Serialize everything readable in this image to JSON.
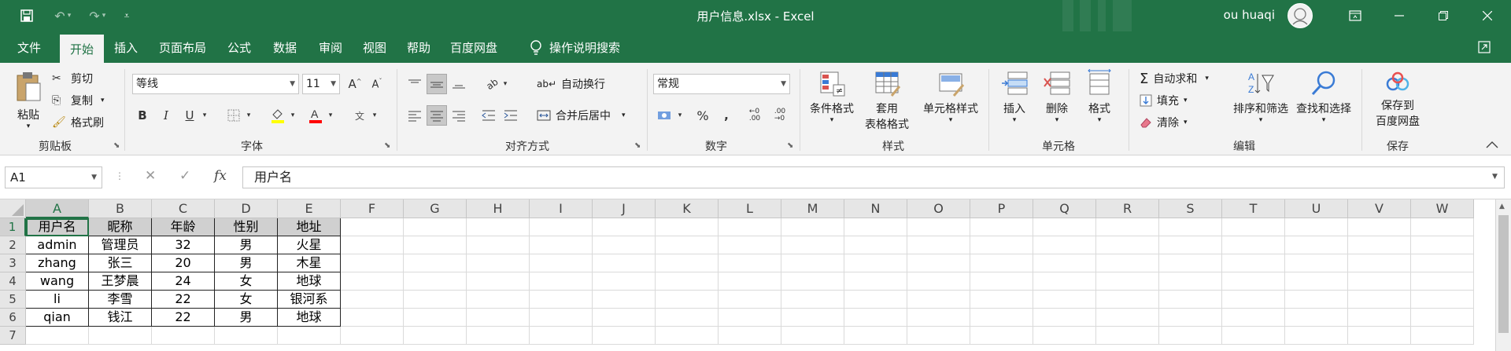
{
  "titlebar": {
    "doc_title": "用户信息.xlsx  -  Excel",
    "user_name": "ou huaqi",
    "brand_color": "#217346"
  },
  "tabs": [
    "文件",
    "开始",
    "插入",
    "页面布局",
    "公式",
    "数据",
    "审阅",
    "视图",
    "帮助",
    "百度网盘"
  ],
  "active_tab": "开始",
  "tell_me": "操作说明搜索",
  "ribbon": {
    "clipboard": {
      "paste": "粘贴",
      "cut": "剪切",
      "copy": "复制",
      "format_painter": "格式刷",
      "label": "剪贴板"
    },
    "font": {
      "name": "等线",
      "size": "11",
      "label": "字体",
      "bold": "B",
      "italic": "I",
      "underline": "U"
    },
    "alignment": {
      "wrap": "自动换行",
      "merge": "合并后居中",
      "label": "对齐方式"
    },
    "number": {
      "format": "常规",
      "label": "数字"
    },
    "styles": {
      "conditional": "条件格式",
      "table_line1": "套用",
      "table_line2": "表格格式",
      "cell_styles": "单元格样式",
      "label": "样式"
    },
    "cells": {
      "insert": "插入",
      "delete": "删除",
      "format": "格式",
      "label": "单元格"
    },
    "editing": {
      "autosum": "自动求和",
      "fill": "填充",
      "clear": "清除",
      "sort": "排序和筛选",
      "find": "查找和选择",
      "label": "编辑"
    },
    "save": {
      "line1": "保存到",
      "line2": "百度网盘",
      "label": "保存"
    }
  },
  "formula_bar": {
    "name_box": "A1",
    "content": "用户名"
  },
  "grid": {
    "columns": [
      "A",
      "B",
      "C",
      "D",
      "E",
      "F",
      "G",
      "H",
      "I",
      "J",
      "K",
      "L",
      "M",
      "N",
      "O",
      "P",
      "Q",
      "R",
      "S",
      "T",
      "U",
      "V",
      "W"
    ],
    "rows": [
      "1",
      "2",
      "3",
      "4",
      "5",
      "6",
      "7"
    ],
    "header_row": [
      "用户名",
      "昵称",
      "年龄",
      "性别",
      "地址"
    ],
    "data": [
      [
        "admin",
        "管理员",
        "32",
        "男",
        "火星"
      ],
      [
        "zhang",
        "张三",
        "20",
        "男",
        "木星"
      ],
      [
        "wang",
        "王梦晨",
        "24",
        "女",
        "地球"
      ],
      [
        "li",
        "李雪",
        "22",
        "女",
        "银河系"
      ],
      [
        "qian",
        "钱江",
        "22",
        "男",
        "地球"
      ]
    ]
  }
}
